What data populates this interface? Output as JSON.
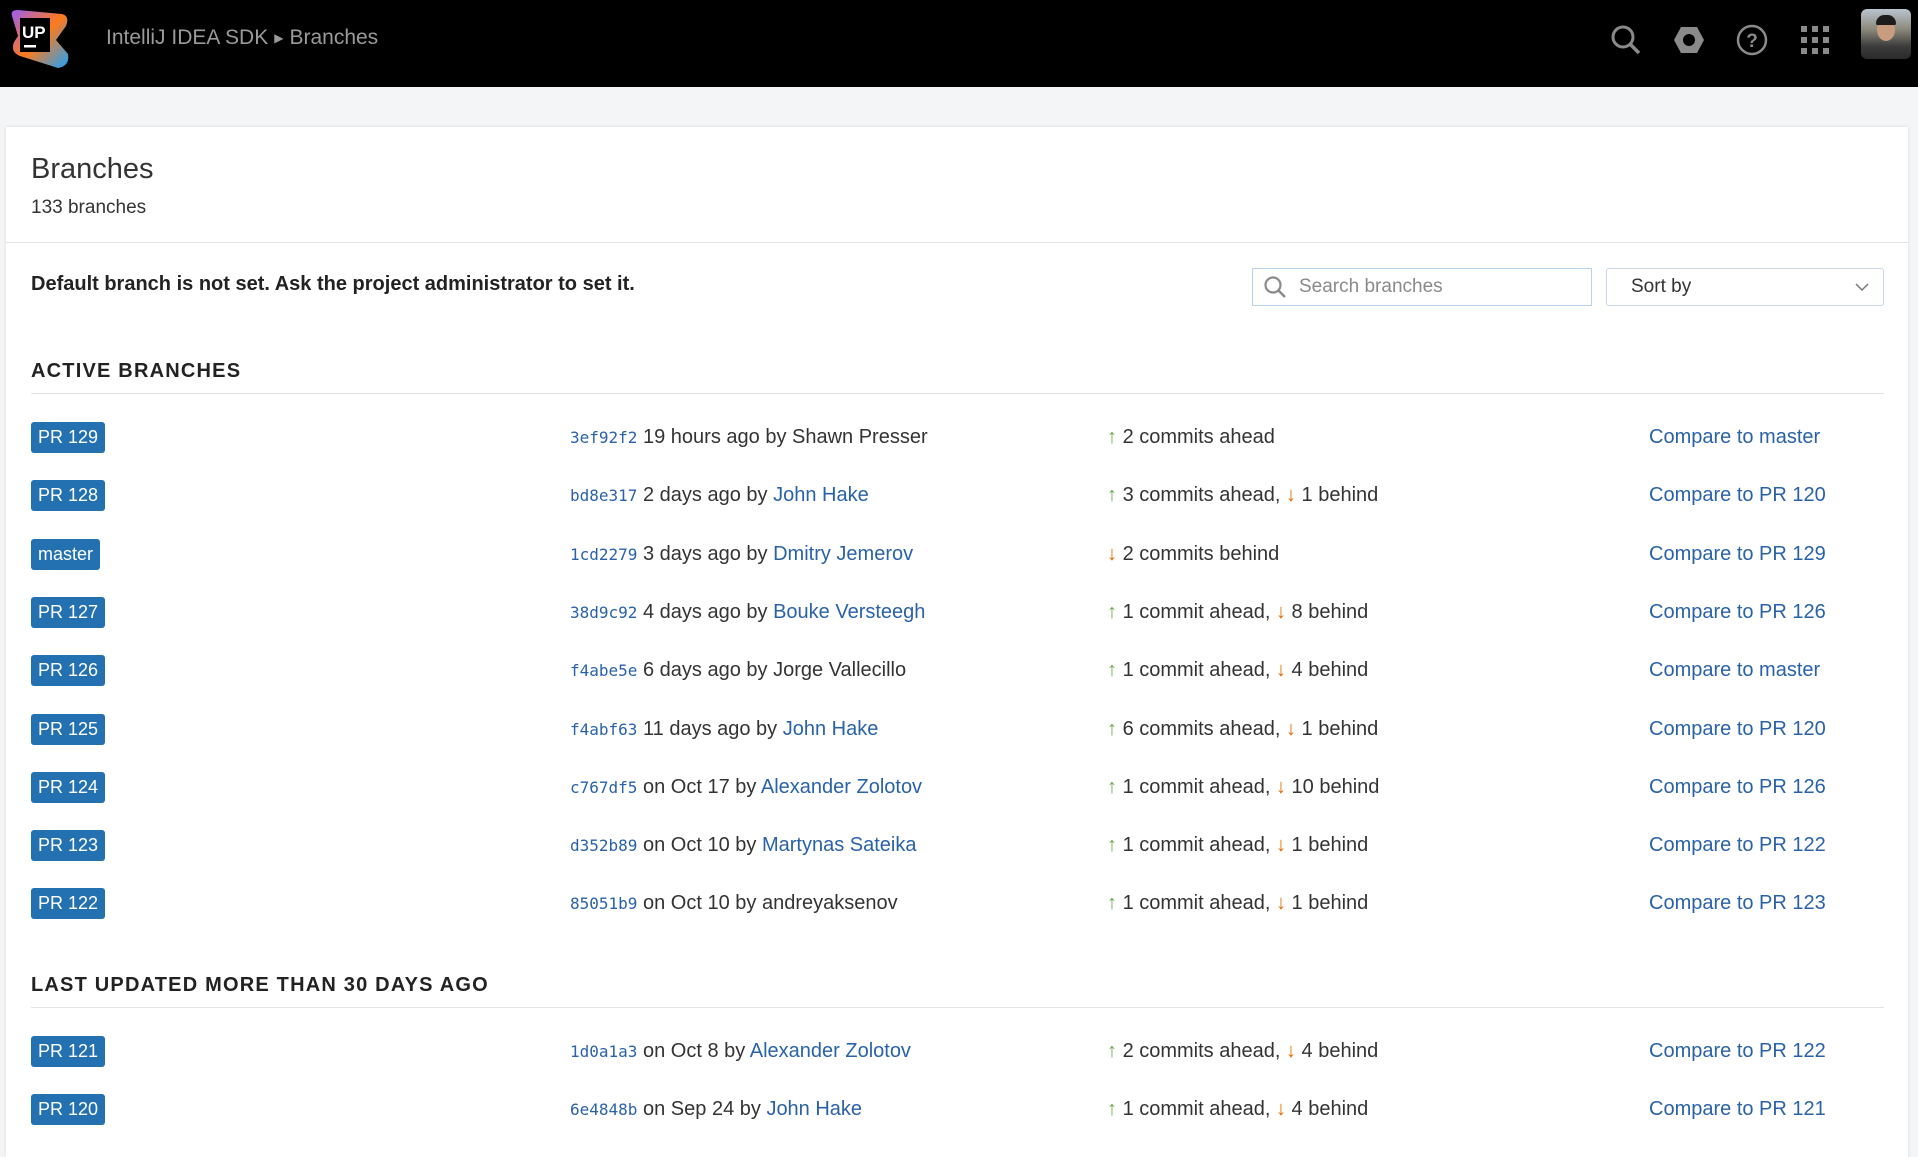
{
  "header": {
    "logo_text": "UP",
    "breadcrumb": [
      "IntelliJ IDEA SDK",
      "Branches"
    ],
    "icons": [
      "search-icon",
      "settings-icon",
      "help-icon",
      "apps-grid-icon"
    ]
  },
  "page": {
    "title": "Branches",
    "count": "133 branches",
    "notice": "Default branch is not set. Ask the project administrator to set it.",
    "search_placeholder": "Search branches",
    "sort_label": "Sort by"
  },
  "colors": {
    "badge": "#2371b1",
    "link": "#2a62a8",
    "ahead": "#6aa84f",
    "behind": "#e06c00"
  },
  "sections": [
    {
      "title": "ACTIVE BRANCHES",
      "rows": [
        {
          "branch": "PR 129",
          "hash": "3ef92f2",
          "when": "19 hours ago by",
          "author": "Shawn Presser",
          "author_link": false,
          "ahead": "2 commits ahead",
          "behind": "",
          "compare": "Compare to master"
        },
        {
          "branch": "PR 128",
          "hash": "bd8e317",
          "when": "2 days ago by",
          "author": "John Hake",
          "author_link": true,
          "ahead": "3 commits ahead,",
          "behind": "1 behind",
          "compare": "Compare to PR 120"
        },
        {
          "branch": "master",
          "hash": "1cd2279",
          "when": "3 days ago by",
          "author": "Dmitry Jemerov",
          "author_link": true,
          "ahead": "",
          "behind": "2 commits behind",
          "compare": "Compare to PR 129"
        },
        {
          "branch": "PR 127",
          "hash": "38d9c92",
          "when": "4 days ago by",
          "author": "Bouke Versteegh",
          "author_link": true,
          "ahead": "1 commit ahead,",
          "behind": "8 behind",
          "compare": "Compare to PR 126"
        },
        {
          "branch": "PR 126",
          "hash": "f4abe5e",
          "when": "6 days ago by",
          "author": "Jorge Vallecillo",
          "author_link": false,
          "ahead": "1 commit ahead,",
          "behind": "4 behind",
          "compare": "Compare to master"
        },
        {
          "branch": "PR 125",
          "hash": "f4abf63",
          "when": "11 days ago by",
          "author": "John Hake",
          "author_link": true,
          "ahead": "6 commits ahead,",
          "behind": "1 behind",
          "compare": "Compare to PR 120"
        },
        {
          "branch": "PR 124",
          "hash": "c767df5",
          "when": "on Oct 17 by",
          "author": "Alexander Zolotov",
          "author_link": true,
          "ahead": "1 commit ahead,",
          "behind": "10 behind",
          "compare": "Compare to PR 126"
        },
        {
          "branch": "PR 123",
          "hash": "d352b89",
          "when": "on Oct 10 by",
          "author": "Martynas Sateika",
          "author_link": true,
          "ahead": "1 commit ahead,",
          "behind": "1 behind",
          "compare": "Compare to PR 122"
        },
        {
          "branch": "PR 122",
          "hash": "85051b9",
          "when": "on Oct 10 by",
          "author": "andreyaksenov",
          "author_link": false,
          "ahead": "1 commit ahead,",
          "behind": "1 behind",
          "compare": "Compare to PR 123"
        }
      ]
    },
    {
      "title": "LAST UPDATED MORE THAN 30 DAYS AGO",
      "rows": [
        {
          "branch": "PR 121",
          "hash": "1d0a1a3",
          "when": "on Oct 8 by",
          "author": "Alexander Zolotov",
          "author_link": true,
          "ahead": "2 commits ahead,",
          "behind": "4 behind",
          "compare": "Compare to PR 122"
        },
        {
          "branch": "PR 120",
          "hash": "6e4848b",
          "when": "on Sep 24 by",
          "author": "John Hake",
          "author_link": true,
          "ahead": "1 commit ahead,",
          "behind": "4 behind",
          "compare": "Compare to PR 121"
        }
      ]
    }
  ]
}
